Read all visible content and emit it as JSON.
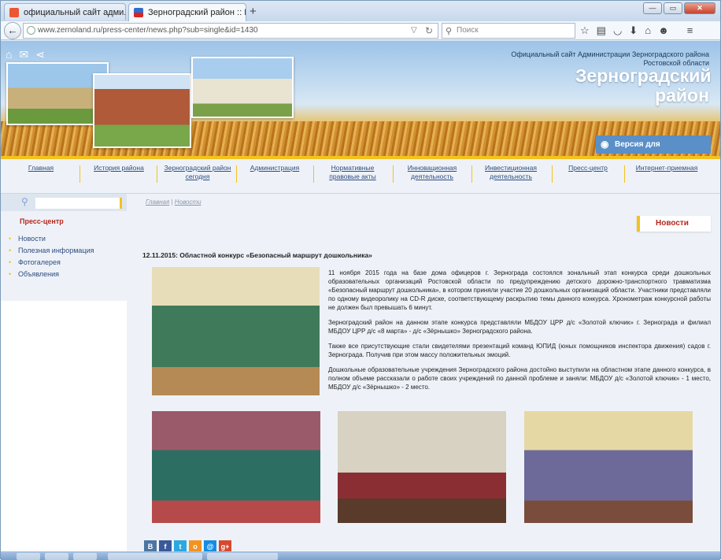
{
  "browser": {
    "tabs": [
      {
        "title": "официальный сайт адми...",
        "active": false
      },
      {
        "title": "Зерноградский район :: Н...",
        "active": true
      }
    ],
    "new_tab": "+",
    "url": "www.zernoland.ru/press-center/news.php?sub=single&id=1430",
    "search_placeholder": "Поиск",
    "window_buttons": {
      "minimize": "—",
      "maximize": "▭",
      "close": "✕"
    }
  },
  "site": {
    "official_line": "Официальный сайт Администрации Зерноградского района Ростовской области",
    "district_name": "Зерноградский район",
    "low_vision": "Версия для слабовидящих",
    "menu": [
      "Главная",
      "История района",
      "Зерноградский район сегодня",
      "Администрация",
      "Нормативные правовые акты",
      "Инновационная деятельность",
      "Инвестиционная деятельность",
      "Пресс-центр",
      "Интернет-приемная"
    ]
  },
  "sidebar": {
    "section": "Пресс-центр",
    "items": [
      "Новости",
      "Полезная информация",
      "Фотогалерея",
      "Объявления"
    ]
  },
  "content": {
    "breadcrumbs": {
      "home": "Главная",
      "sep": " | ",
      "current": "Новости"
    },
    "section_title": "Новости",
    "headline": "12.11.2015: Областной конкурс «Безопасный маршрут дошкольника»",
    "paragraphs": [
      "11 ноября 2015 года на базе дома офицеров г. Зернограда состоялся зональный этап конкурса среди дошкольных образовательных организаций Ростовской области по предупреждению детского дорожно-транспортного травматизма «Безопасный маршрут дошкольника», в котором приняли участие 20 дошкольных организаций области. Участники представляли по одному видеоролику на CD-R диске, соответствующему раскрытию темы данного конкурса. Хронометраж конкурсной работы не должен был превышать 6 минут.",
      "Зерноградский район на данном этапе конкурса представляли МБДОУ ЦРР д/с «Золотой ключик» г. Зернограда и филиал МБДОУ ЦРР д/с «8 марта» - д/с «Зёрнышко» Зерноградского района.",
      "Также все присутствующие стали свидетелями презентаций команд ЮПИД (юных помощников инспектора движения) садов г. Зернограда. Получив при этом массу положительных эмоций.",
      "Дошкольные образовательные учреждения Зерноградского района достойно выступили на областном этапе данного конкурса, в полном объеме рассказали о работе своих учреждений по данной проблеме и заняли: МБДОУ д/с «Золотой ключик» - 1 место, МБДОУ д/с «Зёрнышко» - 2 место."
    ],
    "share": [
      "В",
      "f",
      "t",
      "o",
      "@",
      "g+"
    ]
  },
  "colors": {
    "accent_yellow": "#f3c21f",
    "link_blue": "#2e4d7f",
    "title_red": "#b5261e",
    "lowvis_blue": "#5a8fc8"
  }
}
